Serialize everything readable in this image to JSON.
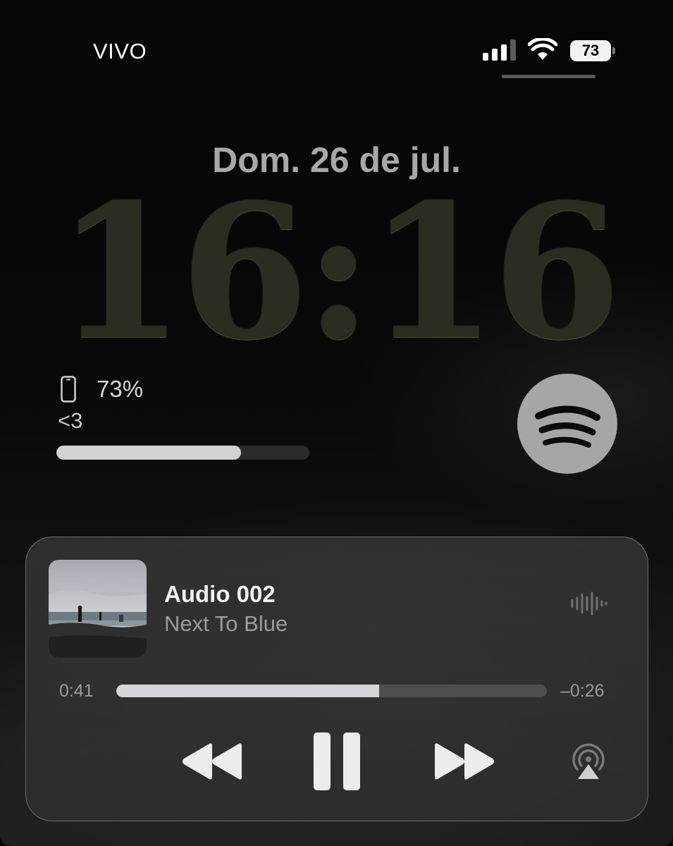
{
  "status_bar": {
    "carrier": "VIVO",
    "battery_level": "73",
    "signal_bars": 4
  },
  "lock_screen": {
    "date": "Dom. 26 de jul.",
    "time": "16:16"
  },
  "battery_widget": {
    "percentage": "73%",
    "device_label": "<3",
    "level": 0.73,
    "icon": "phone-icon"
  },
  "spotify_widget": {
    "icon": "spotify-icon",
    "color": "#a6a6a6"
  },
  "now_playing": {
    "title": "Audio 002",
    "artist": "Next To Blue",
    "elapsed": "0:41",
    "remaining": "–0:26",
    "progress": 0.61,
    "controls": [
      "rewind-icon",
      "pause-icon",
      "fast-forward-icon",
      "airplay-icon"
    ]
  },
  "colors": {
    "clock": "#2c2c21",
    "date": "#a8a8a8",
    "progress_fill": "#d4d4d9"
  }
}
